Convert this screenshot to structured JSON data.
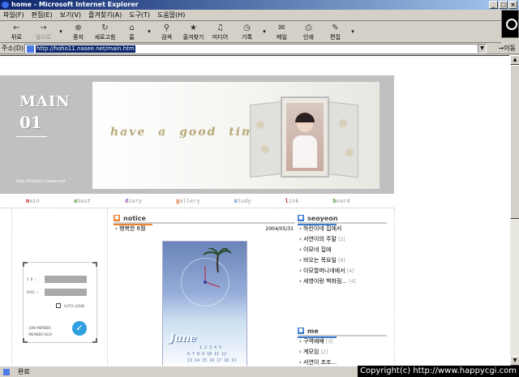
{
  "window": {
    "title": "home - Microsoft Internet Explorer",
    "min": "_",
    "max": "□",
    "close": "×"
  },
  "menu": [
    "파일(F)",
    "편집(E)",
    "보기(V)",
    "즐겨찾기(A)",
    "도구(T)",
    "도움말(H)"
  ],
  "toolbar": [
    {
      "label": "뒤로",
      "icon": "←",
      "disabled": false,
      "name": "back"
    },
    {
      "label": "앞으로",
      "icon": "→",
      "disabled": true,
      "name": "forward"
    },
    {
      "label": "중지",
      "icon": "⊗",
      "disabled": false,
      "name": "stop"
    },
    {
      "label": "새로고침",
      "icon": "↻",
      "disabled": false,
      "name": "refresh"
    },
    {
      "label": "홈",
      "icon": "⌂",
      "disabled": false,
      "name": "home"
    },
    {
      "label": "검색",
      "icon": "⚲",
      "disabled": false,
      "name": "search"
    },
    {
      "label": "즐겨찾기",
      "icon": "★",
      "disabled": false,
      "name": "favorites"
    },
    {
      "label": "미디어",
      "icon": "♫",
      "disabled": false,
      "name": "media"
    },
    {
      "label": "기록",
      "icon": "◷",
      "disabled": false,
      "name": "history"
    },
    {
      "label": "메일",
      "icon": "✉",
      "disabled": false,
      "name": "mail"
    },
    {
      "label": "인쇄",
      "icon": "⎙",
      "disabled": false,
      "name": "print"
    },
    {
      "label": "편집",
      "icon": "✎",
      "disabled": false,
      "name": "edit"
    }
  ],
  "address": {
    "label": "주소(D)",
    "url": "http://hoho11.nasee.net/main.htm",
    "go": "→이동"
  },
  "status": {
    "text": "완료"
  },
  "copyright": "Copyright(c) http://www.happycgi.com",
  "header": {
    "main": "MAIN",
    "num": "01",
    "small": "http://hoho11.nasee.net",
    "tagline": "have a good time"
  },
  "nav": [
    {
      "first": "m",
      "rest": "ain",
      "name": "nav-main"
    },
    {
      "first": "a",
      "rest": "bout",
      "name": "nav-about"
    },
    {
      "first": "d",
      "rest": "iary",
      "name": "nav-diary"
    },
    {
      "first": "g",
      "rest": "allery",
      "name": "nav-gallery"
    },
    {
      "first": "s",
      "rest": "tudy",
      "name": "nav-study"
    },
    {
      "first": "l",
      "rest": "ink",
      "name": "nav-link"
    },
    {
      "first": "b",
      "rest": "oard",
      "name": "nav-board"
    }
  ],
  "login": {
    "id_label": "I D :",
    "pass_label": "PASS :",
    "auto_login": "AUTO LOGIN",
    "join": "· JOIN MEMBER",
    "help": "· MEMBER HELP"
  },
  "notice": {
    "title": "notice",
    "items": [
      {
        "text": "› 행복한 6월",
        "date": "2004/05/31"
      }
    ]
  },
  "calendar": {
    "month": "June",
    "row1": "1 2 3 4 5",
    "row2": "6 7 8 9 10 11 12",
    "row3": "13 14 15 16 17 18 19"
  },
  "seoyeon": {
    "title": "seoyeon",
    "items": [
      {
        "text": "› 하린이네 집에서",
        "count": ""
      },
      {
        "text": "› 서연이의 주말",
        "count": "[2]"
      },
      {
        "text": "› 이모네 집에",
        "count": ""
      },
      {
        "text": "› 비오는 목요일",
        "count": "[6]"
      },
      {
        "text": "› 이모할머니네에서",
        "count": "[4]"
      },
      {
        "text": "› 세영이랑 백화점...",
        "count": "[4]"
      }
    ]
  },
  "me": {
    "title": "me",
    "items": [
      {
        "text": "› 구역예배",
        "count": "[3]"
      },
      {
        "text": "› 계모임",
        "count": "[2]"
      },
      {
        "text": "› 서연이 조조...",
        "count": ""
      }
    ]
  }
}
